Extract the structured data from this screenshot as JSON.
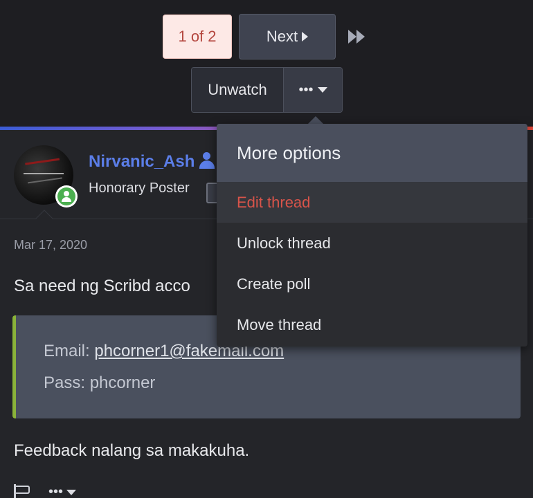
{
  "pagination": {
    "current": "1 of 2",
    "next_label": "Next"
  },
  "watch": {
    "unwatch_label": "Unwatch",
    "more_label": "•••"
  },
  "post": {
    "username": "Nirvanic_Ash",
    "user_title": "Honorary Poster",
    "date": "Mar 17, 2020",
    "text": "Sa need ng Scribd acco",
    "quote": {
      "email_label": "Email: ",
      "email_value": "phcorner1@fakemail.com",
      "pass_label": "Pass: phcorner"
    },
    "feedback": "Feedback nalang sa makakuha.",
    "more_label": "•••"
  },
  "menu": {
    "header": "More options",
    "items": [
      {
        "label": "Edit thread",
        "active": true
      },
      {
        "label": "Unlock thread"
      },
      {
        "label": "Create poll"
      },
      {
        "label": "Move thread"
      }
    ]
  },
  "colors": {
    "accent_link": "#5b7ee8",
    "active_menu_text": "#d8544a",
    "online": "#4caf50",
    "quote_border": "#8ab33a"
  },
  "icons": [
    "chevron-right-icon",
    "last-page-icon",
    "ellipsis-icon",
    "caret-down-icon",
    "user-icon",
    "online-user-icon",
    "flag-icon"
  ]
}
